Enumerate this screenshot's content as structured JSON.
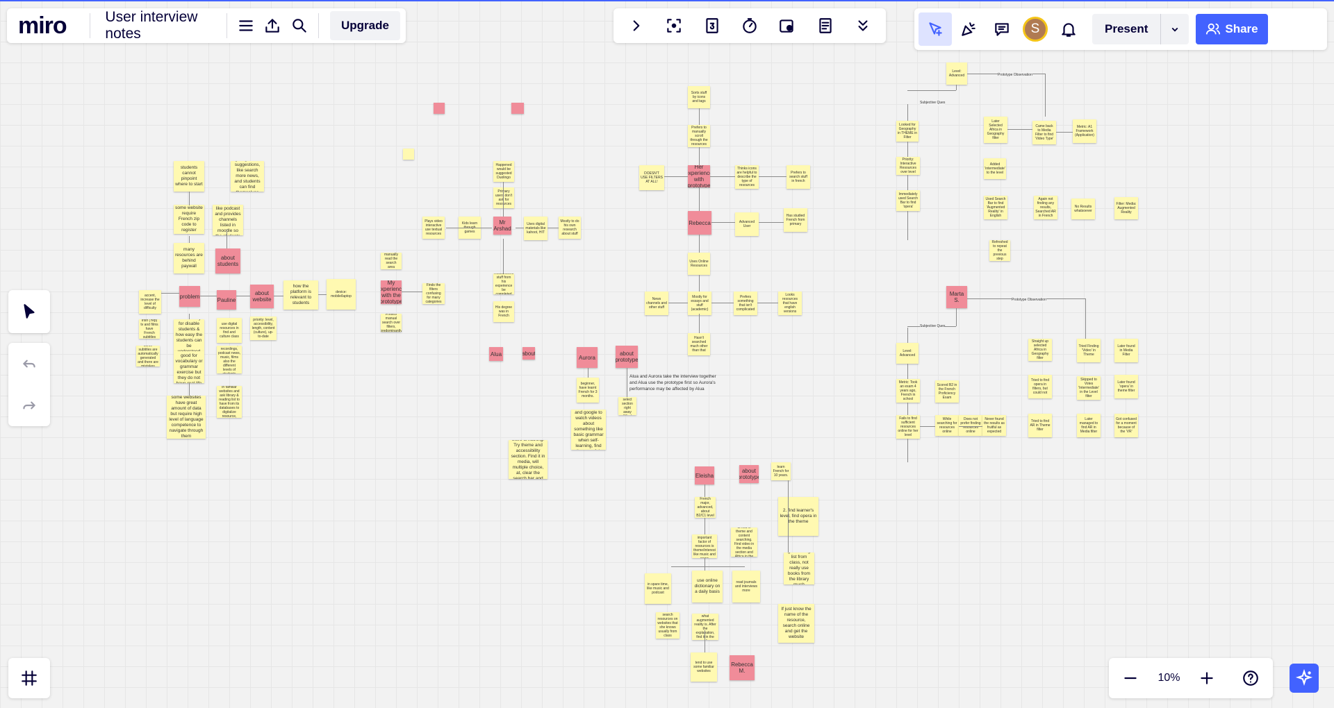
{
  "app": {
    "logo": "miro",
    "board_title": "User interview notes",
    "upgrade_label": "Upgrade"
  },
  "toolbar_left": {
    "icons": [
      "menu-icon",
      "export-icon",
      "search-icon"
    ]
  },
  "toolbar_center": {
    "icons": [
      "chevron-right-icon",
      "focus-frame-icon",
      "card-3-icon",
      "timer-icon",
      "voting-icon",
      "notes-list-icon",
      "more-chevron-icon"
    ]
  },
  "toolbar_right": {
    "avatar_initial": "S",
    "present_label": "Present",
    "share_label": "Share"
  },
  "zoom": {
    "value": "10%"
  },
  "board": {
    "annotation": "Alua and Aurora take the interview together and Alua use the prototype first so Aurora's performance may be affected by Alua",
    "connector_labels": [
      "Prototype Observation",
      "Subjective Ques",
      "Prototype Observation",
      "Subjective Ques"
    ],
    "notes": [
      {
        "t": "students cannot pinpoint where to start",
        "k": "y"
      },
      {
        "t": "give general suggestions, like search more news, and students can find themselves",
        "k": "y"
      },
      {
        "t": "some website require French zip code to register",
        "k": "y"
      },
      {
        "t": "there are resources like podcast and provides channels listed in moodle so the students can visit",
        "k": "y"
      },
      {
        "t": "many resources are behind paywall",
        "k": "y"
      },
      {
        "t": "about students",
        "k": "p"
      },
      {
        "t": "accent, increase the level of difficulty",
        "k": "y"
      },
      {
        "t": "problem",
        "k": "p"
      },
      {
        "t": "Pauline",
        "k": "p"
      },
      {
        "t": "about website",
        "k": "p"
      },
      {
        "t": "how the platform is relevant to students",
        "k": "y"
      },
      {
        "t": "device: mobile/laptop",
        "k": "y"
      },
      {
        "t": "Irish (Yep) tv and films have French subtitles",
        "k": "y"
      },
      {
        "t": "accessibility for disable students & how easy the students can be understood",
        "k": "y"
      },
      {
        "t": "use digital resources in find and culture class",
        "k": "y"
      },
      {
        "t": "priority: level, accessibility, length, content (culture), up-to-date",
        "k": "y"
      },
      {
        "t": "some subtitles are automatically generated and there are mistakes",
        "k": "y"
      },
      {
        "t": "some resources are good for vocabulary or grammar exercise but they do not have real life context",
        "k": "y"
      },
      {
        "t": "use videos, recordings, podcast news, music, films also the different levels of students",
        "k": "y"
      },
      {
        "t": "some websites have great amount of data but require high level of language competence to navigate through them",
        "k": "y"
      },
      {
        "t": "find resources in familiar websites and ask library & reading list to have from its databases to digitalize resource, from PhD",
        "k": "y"
      },
      {
        "t": "My experience with the prototype",
        "k": "p"
      },
      {
        "t": "Used to manually read the search area everytime",
        "k": "y"
      },
      {
        "t": "Prefers manual search over filters, predominantly",
        "k": "y"
      },
      {
        "t": "Finds the filters confusing for many categories",
        "k": "y"
      },
      {
        "t": "Mr Arshad",
        "k": "p"
      },
      {
        "t": "Plays video interactive use textual resources",
        "k": "y"
      },
      {
        "t": "Kids learn through games",
        "k": "y"
      },
      {
        "t": "Uses digital materials like kahoot, HIT",
        "k": "y"
      },
      {
        "t": "Mostly to do his own research about stuff",
        "k": "y"
      },
      {
        "t": "Happened would be suggested Duolingo",
        "k": "y"
      },
      {
        "t": "Primary users don't ask for resources",
        "k": "y"
      },
      {
        "t": "His degree was in French",
        "k": "y"
      },
      {
        "t": "Researchers stuff from his experience be completed",
        "k": "y"
      },
      {
        "t": "Alua",
        "k": "p"
      },
      {
        "t": "about",
        "k": "p"
      },
      {
        "t": "Aurora",
        "k": "p"
      },
      {
        "t": "about prototype",
        "k": "p"
      },
      {
        "t": "beginner, have learnt French for 3 months.",
        "k": "y"
      },
      {
        "t": "use select section right away (filter)",
        "k": "y"
      },
      {
        "t": "use duolingo and google to watch videos about something like basic grammar when self-learning, find them useful.",
        "k": "y"
      },
      {
        "t": "1. use the search bar to find 'Al' but there is nothing. Try theme and accessibility section. Find it in media, will multiple choice, at, clear the search bar and the resources show up",
        "k": "y"
      },
      {
        "t": "Sorts stuff by icons and tags",
        "k": "y"
      },
      {
        "t": "Prefers to manually scroll through the resources",
        "k": "y"
      },
      {
        "t": "DOESN'T USE FILTERS AT ALL!",
        "k": "y"
      },
      {
        "t": "Her experience with prototype",
        "k": "p"
      },
      {
        "t": "Thinks icons are helpful to describe the type of resources",
        "k": "y"
      },
      {
        "t": "Prefers to search stuff in french",
        "k": "y"
      },
      {
        "t": "Rebecca",
        "k": "p"
      },
      {
        "t": "Advanced User",
        "k": "y"
      },
      {
        "t": "Has studied French from primary",
        "k": "y"
      },
      {
        "t": "Uses Online Resources",
        "k": "y"
      },
      {
        "t": "News channels and other stuff",
        "k": "y"
      },
      {
        "t": "Mostly for essays and stuff (academic)",
        "k": "y"
      },
      {
        "t": "Prefers something that isn't complicated",
        "k": "y"
      },
      {
        "t": "Looks resources that have english versions",
        "k": "y"
      },
      {
        "t": "Hasn't searched much other than that",
        "k": "y"
      },
      {
        "t": "Eleisha",
        "k": "p"
      },
      {
        "t": "about prototype",
        "k": "p"
      },
      {
        "t": "learn French for 10 years.",
        "k": "y"
      },
      {
        "t": "French major, advanced, about B2/C1 level",
        "k": "y"
      },
      {
        "t": "the most important factor of resources is theme/interest like music and news",
        "k": "y"
      },
      {
        "t": "1. use the search bar to search about Africa nothing shows up. Try to find in theme and content searching. Find video in the media section and Africa in the geography section, find resources after clearing the research bar",
        "k": "y"
      },
      {
        "t": "2. find learner's level, find opera in the theme",
        "k": "y"
      },
      {
        "t": "get reading list from class, not really use books from the library much",
        "k": "y"
      },
      {
        "t": "in spare time, like music and podcast",
        "k": "y"
      },
      {
        "t": "use online dictionary on a daily basis",
        "k": "y"
      },
      {
        "t": "read journals and interviews more",
        "k": "y"
      },
      {
        "t": "search resources on websites that she knows usually from class",
        "k": "y"
      },
      {
        "t": "3. don't know what augmented reality is. After the explanation, find it in the media.",
        "k": "y"
      },
      {
        "t": "If just know the name of the resource, search online and get the website",
        "k": "y"
      },
      {
        "t": "tend to use some familiar websites",
        "k": "y"
      },
      {
        "t": "Rebecca M.",
        "k": "p"
      },
      {
        "t": "Level: Advanced",
        "k": "y"
      },
      {
        "t": "Looked for Geography in THEME in Filter",
        "k": "y"
      },
      {
        "t": "Later Selected Africa in Geography filter",
        "k": "y"
      },
      {
        "t": "Came back to Media Filter to find 'Video Type'",
        "k": "y"
      },
      {
        "t": "Metric: A1 Framework (Application)",
        "k": "y"
      },
      {
        "t": "Priority: Interactive Resources over level",
        "k": "y"
      },
      {
        "t": "Immediately used Search Bar to find 'opera'",
        "k": "y"
      },
      {
        "t": "Added 'intermediate' to the level",
        "k": "y"
      },
      {
        "t": "Used Search Bar to find 'Augmented Reality' in English",
        "k": "y"
      },
      {
        "t": "Again not finding any results, Searched AR in French",
        "k": "y"
      },
      {
        "t": "No Results whatsoever",
        "k": "y"
      },
      {
        "t": "Filter: Media: Augmented Reality",
        "k": "y"
      },
      {
        "t": "Refreshed to repeat the previous step",
        "k": "y"
      },
      {
        "t": "Marta S.",
        "k": "p"
      },
      {
        "t": "Level: Advanced",
        "k": "y"
      },
      {
        "t": "Straight up selected Africa in Geography filter",
        "k": "y"
      },
      {
        "t": "Tried Finding 'Video' in Theme",
        "k": "y"
      },
      {
        "t": "Later found in Media Filter",
        "k": "y"
      },
      {
        "t": "Metric: Took an exam 4 years ago, French in school",
        "k": "y"
      },
      {
        "t": "Scored B2 in the French Proficiency Exam",
        "k": "y"
      },
      {
        "t": "Tried to find opera in filters, but could not",
        "k": "y"
      },
      {
        "t": "Skipped to Votes 'Intermediate' in the Level filter",
        "k": "y"
      },
      {
        "t": "Later found 'opera' in theme filter",
        "k": "y"
      },
      {
        "t": "Fails to find sufficient resources online for her level",
        "k": "y"
      },
      {
        "t": "While searching for resources online",
        "k": "y"
      },
      {
        "t": "Does not prefer finding resources online",
        "k": "y"
      },
      {
        "t": "Never found the results as fruitful as expected",
        "k": "y"
      },
      {
        "t": "Tried to find AR in Theme filter",
        "k": "y"
      },
      {
        "t": "Later managed to find AR in Media filter",
        "k": "y"
      },
      {
        "t": "Got confused for a moment because of the 'VR'",
        "k": "y"
      }
    ]
  }
}
